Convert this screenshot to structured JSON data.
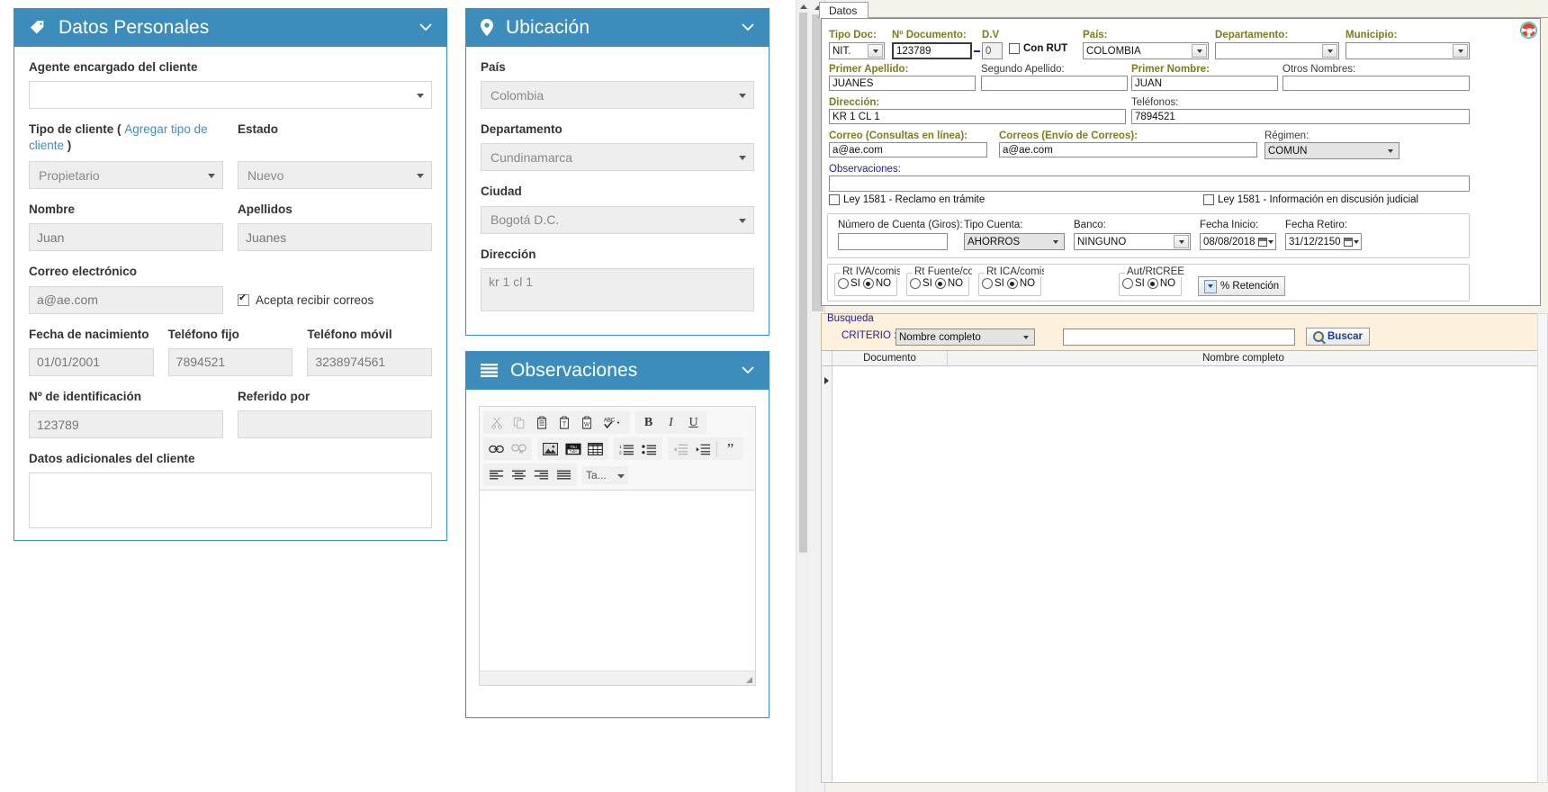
{
  "web": {
    "personal": {
      "title": "Datos Personales",
      "icon": "tag-icon",
      "collapse_icon": "chevron-down-icon",
      "agent_label": "Agente encargado del cliente",
      "agent_value": "",
      "client_type_label": "Tipo de cliente (",
      "client_type_link": "Agregar tipo de cliente",
      "client_type_label_end": ")",
      "client_type_value": "Propietario",
      "estado_label": "Estado",
      "estado_value": "Nuevo",
      "nombre_label": "Nombre",
      "nombre_value": "Juan",
      "apellidos_label": "Apellidos",
      "apellidos_value": "Juanes",
      "correo_label": "Correo electrónico",
      "correo_value": "a@ae.com",
      "accept_mail_label": "Acepta recibir correos",
      "accept_mail_checked": true,
      "fecha_nac_label": "Fecha de nacimiento",
      "fecha_nac_value": "01/01/2001",
      "tel_fijo_label": "Teléfono fijo",
      "tel_fijo_value": "7894521",
      "tel_movil_label": "Teléfono móvil",
      "tel_movil_value": "3238974561",
      "num_id_label": "Nº de identificación",
      "num_id_value": "123789",
      "referido_label": "Referido por",
      "referido_value": "",
      "extra_label": "Datos adicionales del cliente",
      "extra_value": ""
    },
    "ubicacion": {
      "title": "Ubicación",
      "icon": "map-pin-icon",
      "collapse_icon": "chevron-down-icon",
      "pais_label": "País",
      "pais_value": "Colombia",
      "depto_label": "Departamento",
      "depto_value": "Cundinamarca",
      "ciudad_label": "Ciudad",
      "ciudad_value": "Bogotá D.C.",
      "direccion_label": "Dirección",
      "direccion_value": "kr 1 cl 1"
    },
    "observaciones": {
      "title": "Observaciones",
      "icon": "list-lines-icon",
      "collapse_icon": "chevron-down-icon",
      "editor_value": "",
      "toolbar": {
        "row1": [
          {
            "name": "cut-icon",
            "glyph": "✂",
            "disabled": true
          },
          {
            "name": "copy-icon",
            "glyph": "⎘",
            "disabled": true
          },
          {
            "name": "paste-icon",
            "glyph": "📋",
            "disabled": false
          },
          {
            "name": "paste-as-plain-text-icon",
            "glyph": "T",
            "disabled": false
          },
          {
            "name": "paste-from-word-icon",
            "glyph": "W",
            "disabled": false
          },
          {
            "name": "spellcheck-icon",
            "glyph": "ABC",
            "disabled": false
          },
          {
            "name": "bold-icon",
            "glyph": "B",
            "disabled": false
          },
          {
            "name": "italic-icon",
            "glyph": "I",
            "disabled": false
          },
          {
            "name": "underline-icon",
            "glyph": "U",
            "disabled": false
          }
        ],
        "row2": [
          {
            "name": "link-icon",
            "glyph": "🔗",
            "disabled": false
          },
          {
            "name": "unlink-icon",
            "glyph": "🔗",
            "disabled": true
          },
          {
            "name": "image-icon",
            "glyph": "🖼",
            "disabled": false
          },
          {
            "name": "youtube-icon",
            "glyph": "You",
            "disabled": false
          },
          {
            "name": "table-icon",
            "glyph": "▦",
            "disabled": false
          },
          {
            "name": "numbered-list-icon",
            "glyph": "1≡",
            "disabled": false
          },
          {
            "name": "bulleted-list-icon",
            "glyph": "•≡",
            "disabled": false
          },
          {
            "name": "outdent-icon",
            "glyph": "⇤",
            "disabled": true
          },
          {
            "name": "indent-icon",
            "glyph": "⇥",
            "disabled": false
          },
          {
            "name": "blockquote-icon",
            "glyph": "❞",
            "disabled": false
          }
        ],
        "row3": [
          {
            "name": "align-left-icon",
            "glyph": "≡",
            "disabled": false
          },
          {
            "name": "align-center-icon",
            "glyph": "≡",
            "disabled": false
          },
          {
            "name": "align-right-icon",
            "glyph": "≡",
            "disabled": false
          },
          {
            "name": "justify-icon",
            "glyph": "≡",
            "disabled": false
          }
        ],
        "styles_label": "Ta..."
      }
    }
  },
  "winform": {
    "tab_label": "Datos",
    "help_icon": "lifebuoy-help-icon",
    "fields": {
      "tipo_doc_label": "Tipo Doc:",
      "tipo_doc_value": "NIT.",
      "num_doc_label": "Nº Documento:",
      "num_doc_value": "123789",
      "dv_label": "D.V",
      "dv_value": "0",
      "con_rut_label": "Con RUT",
      "con_rut_checked": false,
      "pais_label": "País:",
      "pais_value": "COLOMBIA",
      "departamento_label": "Departamento:",
      "departamento_value": "",
      "municipio_label": "Municipio:",
      "municipio_value": "",
      "primer_apellido_label": "Primer Apellido:",
      "primer_apellido_value": "JUANES",
      "segundo_apellido_label": "Segundo Apellido:",
      "segundo_apellido_value": "",
      "primer_nombre_label": "Primer Nombre:",
      "primer_nombre_value": "JUAN",
      "otros_nombres_label": "Otros Nombres:",
      "otros_nombres_value": "",
      "direccion_label": "Dirección:",
      "direccion_value": "KR 1 CL 1",
      "telefonos_label": "Teléfonos:",
      "telefonos_value": "7894521",
      "correo_consultas_label": "Correo (Consultas en línea):",
      "correo_consultas_value": "a@ae.com",
      "correos_envio_label": "Correos (Envío de Correos):",
      "correos_envio_value": "a@ae.com",
      "regimen_label": "Régimen:",
      "regimen_value": "COMUN",
      "observaciones_label": "Observaciones:",
      "observaciones_value": "",
      "ley_reclamo_label": "Ley 1581 - Reclamo en trámite",
      "ley_reclamo_checked": false,
      "ley_info_label": "Ley 1581 - Información en discusión judicial",
      "ley_info_checked": false,
      "num_cuenta_label": "Número de Cuenta (Giros):",
      "num_cuenta_value": "",
      "tipo_cuenta_label": "Tipo Cuenta:",
      "tipo_cuenta_value": "AHORROS",
      "banco_label": "Banco:",
      "banco_value": "NINGUNO",
      "fecha_inicio_label": "Fecha Inicio:",
      "fecha_inicio_value": "08/08/2018",
      "fecha_retiro_label": "Fecha Retiro:",
      "fecha_retiro_value": "31/12/2150"
    },
    "retentions": [
      {
        "group": "Rt IVA/comisior",
        "si": "SI",
        "no": "NO",
        "selected": "NO"
      },
      {
        "group": "Rt Fuente/comi",
        "si": "SI",
        "no": "NO",
        "selected": "NO"
      },
      {
        "group": "Rt ICA/comisior",
        "si": "SI",
        "no": "NO",
        "selected": "NO"
      },
      {
        "group": "Aut/RtCREE/co",
        "si": "SI",
        "no": "NO",
        "selected": "NO"
      }
    ],
    "retention_button": "% Retención",
    "search": {
      "title": "Busqueda",
      "criterio_label": "CRITERIO :",
      "criterio_value": "Nombre completo",
      "query_value": "",
      "button_label": "Buscar",
      "button_icon": "search-magnifier-icon"
    },
    "grid": {
      "columns": [
        "Documento",
        "Nombre completo"
      ],
      "rows": []
    }
  }
}
